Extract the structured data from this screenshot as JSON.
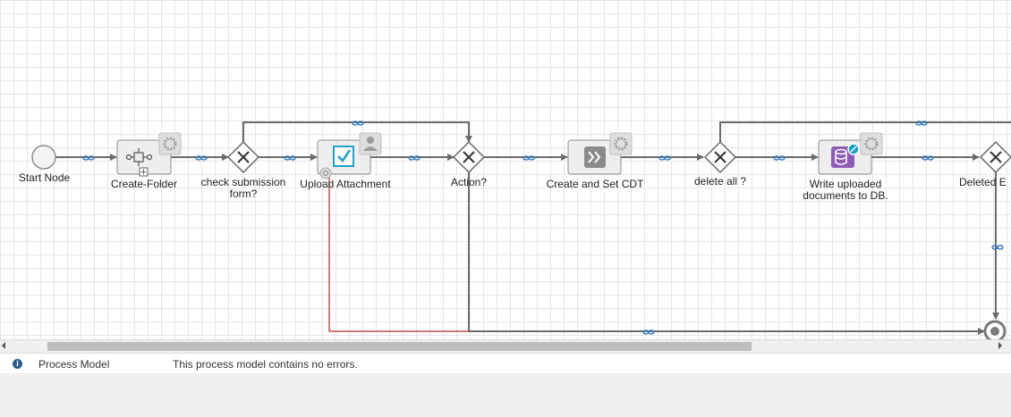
{
  "diagram": {
    "nodes": {
      "start": "Start Node",
      "create_folder": "Create-Folder",
      "check_submission_1": "check submission",
      "check_submission_2": "form?",
      "upload_attachment": "Upload Attachment",
      "action": "Action?",
      "create_set_cdt": "Create and Set CDT",
      "delete_all": "delete all ?",
      "write_uploaded_1": "Write uploaded",
      "write_uploaded_2": "documents to DB.",
      "deleted": "Deleted E"
    },
    "colors": {
      "connector": "#6b6b6b",
      "rejection_path": "#c0504d",
      "node_fill": "#eeeeee",
      "node_border": "#8c8c8c",
      "link_icon": "#3a7fc1",
      "user_task_accent": "#1ea0c8",
      "write_db_accent": "#8e5bb5"
    }
  },
  "status": {
    "icon": "info-icon",
    "source": "Process Model",
    "message": "This process model contains no errors."
  }
}
